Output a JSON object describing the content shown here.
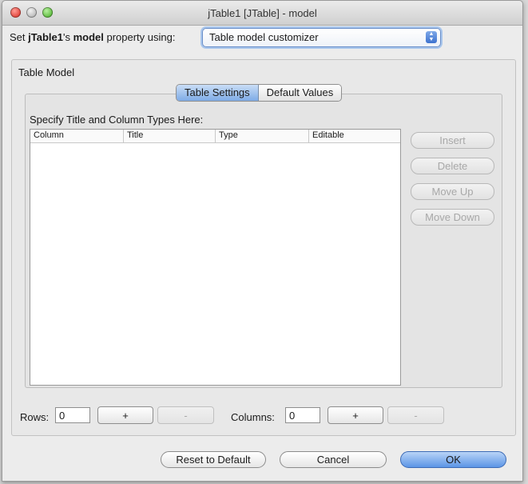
{
  "window": {
    "title": "jTable1 [JTable] - model"
  },
  "set_row": {
    "prefix": "Set ",
    "component": "jTable1",
    "possessive": "'s ",
    "property": "model",
    "suffix": " property using:"
  },
  "combo": {
    "value": "Table model customizer"
  },
  "group": {
    "label": "Table Model"
  },
  "tabs": [
    {
      "label": "Table Settings",
      "active": true
    },
    {
      "label": "Default Values",
      "active": false
    }
  ],
  "panel": {
    "instruction": "Specify Title and Column Types Here:"
  },
  "table": {
    "columns": [
      "Column",
      "Title",
      "Type",
      "Editable"
    ],
    "rows": []
  },
  "side_buttons": {
    "insert": "Insert",
    "delete": "Delete",
    "move_up": "Move Up",
    "move_down": "Move Down"
  },
  "rows_control": {
    "label": "Rows:",
    "value": "0",
    "plus": "+",
    "minus": "-"
  },
  "columns_control": {
    "label": "Columns:",
    "value": "0",
    "plus": "+",
    "minus": "-"
  },
  "footer": {
    "reset": "Reset to Default",
    "cancel": "Cancel",
    "ok": "OK"
  }
}
